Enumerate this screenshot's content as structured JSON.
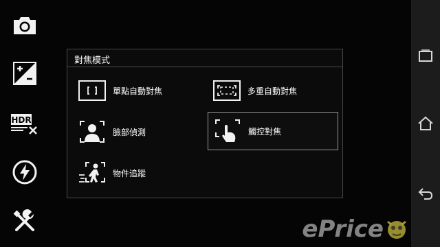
{
  "left_toolbar": {
    "buttons": [
      {
        "name": "camera-icon"
      },
      {
        "name": "exposure-icon"
      },
      {
        "name": "hdr-off-icon",
        "text": "HDR"
      },
      {
        "name": "flash-off-icon"
      },
      {
        "name": "settings-tools-icon"
      }
    ]
  },
  "focus_dialog": {
    "title": "對焦模式",
    "options": [
      {
        "label": "單點自動對焦",
        "icon": "single-point-af-icon",
        "selected": false
      },
      {
        "label": "多重自動對焦",
        "icon": "multi-af-icon",
        "selected": false
      },
      {
        "label": "臉部偵測",
        "icon": "face-detection-icon",
        "selected": false
      },
      {
        "label": "觸控對焦",
        "icon": "touch-focus-icon",
        "selected": true
      },
      {
        "label": "物件追蹤",
        "icon": "object-tracking-icon",
        "selected": false
      }
    ]
  },
  "nav_bar": {
    "buttons": [
      {
        "name": "recent-apps-icon"
      },
      {
        "name": "home-icon"
      },
      {
        "name": "back-icon"
      }
    ]
  },
  "watermark": {
    "text": "ePrice"
  },
  "colors": {
    "selected_border": "#9a9a9a",
    "dialog_border": "#4a4a4a"
  }
}
